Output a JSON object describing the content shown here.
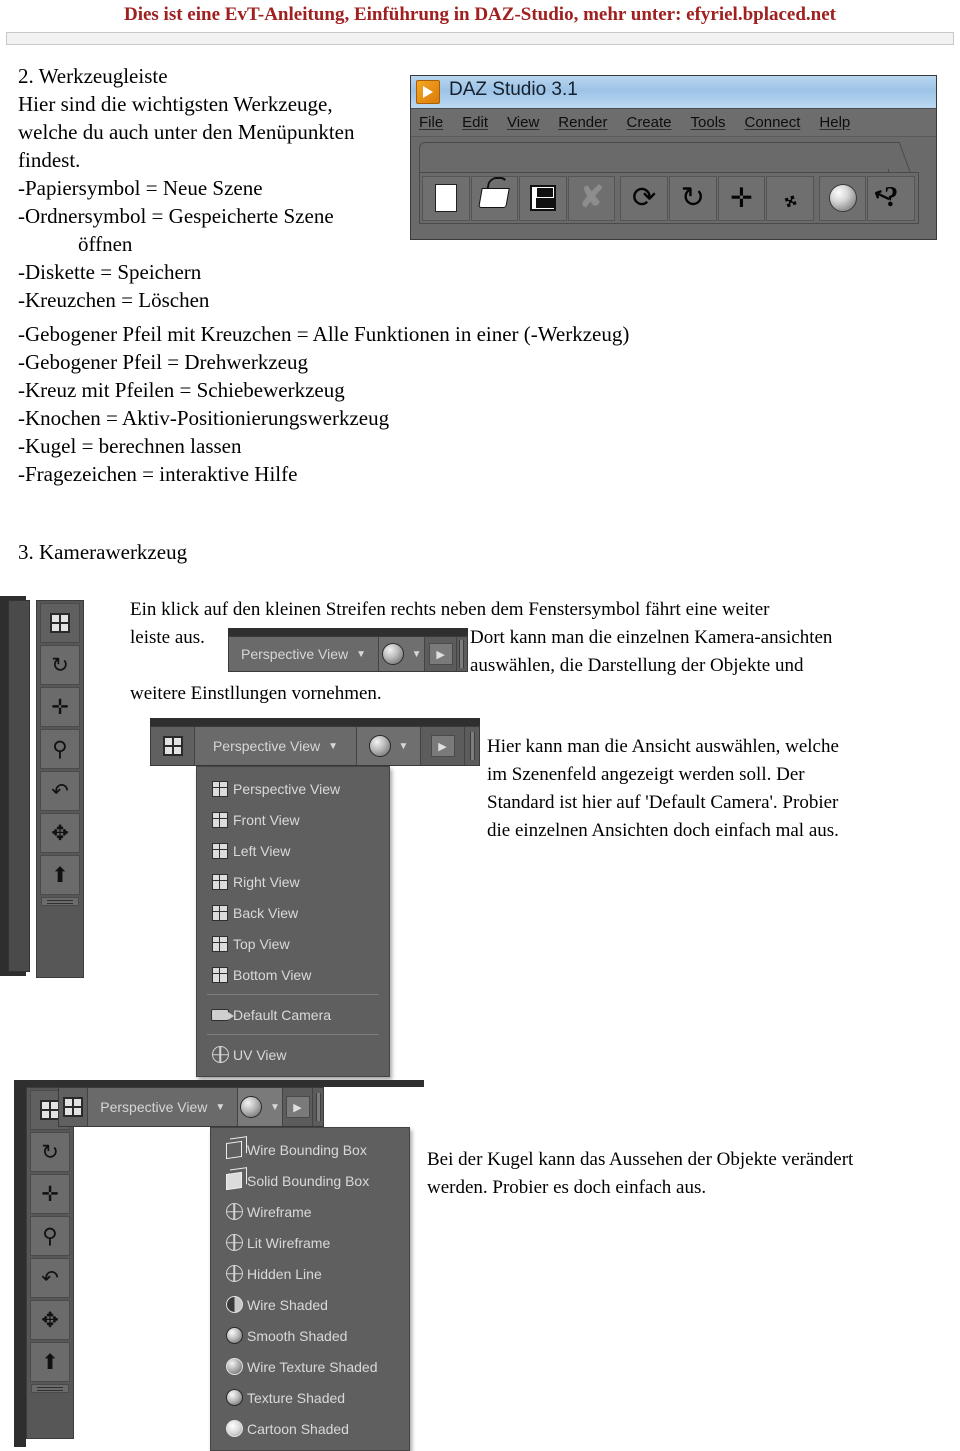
{
  "banner": {
    "text": "Dies ist eine EvT-Anleitung, Einführung in DAZ-Studio, mehr unter: efyriel.bplaced.net",
    "color": "#a02020"
  },
  "section2": {
    "heading": "2. Werkzeugleiste",
    "intro_lines": [
      "Hier sind die wichtigsten Werkzeuge,",
      "welche du auch unter den Menüpunkten",
      "findest."
    ],
    "bullets": [
      "-Papiersymbol = Neue Szene",
      "-Ordnersymbol = Gespeicherte Szene",
      "öffnen",
      "-Diskette = Speichern",
      "-Kreuzchen = Löschen"
    ],
    "wide_bullets": [
      "-Gebogener Pfeil mit Kreuzchen = Alle Funktionen in einer (-Werkzeug)",
      "-Gebogener Pfeil = Drehwerkzeug",
      "-Kreuz mit Pfeilen = Schiebewerkzeug",
      "-Knochen = Aktiv-Positionierungswerkzeug",
      "-Kugel = berechnen lassen",
      "-Fragezeichen = interaktive Hilfe"
    ]
  },
  "daz_window": {
    "title": "DAZ Studio 3.1",
    "menus": [
      "File",
      "Edit",
      "View",
      "Render",
      "Create",
      "Tools",
      "Connect",
      "Help"
    ],
    "toolbar_buttons": [
      {
        "name": "new-scene-button",
        "icon": "page-icon",
        "glyph": ""
      },
      {
        "name": "open-scene-button",
        "icon": "folder-icon",
        "glyph": ""
      },
      {
        "name": "save-scene-button",
        "icon": "floppy-disk-icon",
        "glyph": ""
      },
      {
        "name": "delete-button",
        "icon": "x-cross-icon",
        "glyph": "✘"
      },
      {
        "name": "universal-tool-button",
        "icon": "curved-arrow-cross-icon",
        "glyph": "↻"
      },
      {
        "name": "rotate-tool-button",
        "icon": "curved-arrow-icon",
        "glyph": "↻"
      },
      {
        "name": "translate-tool-button",
        "icon": "four-way-arrow-icon",
        "glyph": "✛"
      },
      {
        "name": "active-pose-tool-button",
        "icon": "bone-icon",
        "glyph": "🦴"
      },
      {
        "name": "render-button",
        "icon": "sphere-icon",
        "glyph": ""
      },
      {
        "name": "help-button",
        "icon": "question-mark-arrow-icon",
        "glyph": "?"
      }
    ]
  },
  "section3": {
    "heading": "3. Kamerawerkzeug",
    "para1_lines": [
      "Ein klick auf den kleinen Streifen rechts neben dem Fenstersymbol fährt eine weiter",
      "leiste aus.",
      "Dort kann man die einzelnen Kamera-ansichten",
      "auswählen, die Darstellung der Objekte und",
      "weitere Einstllungen vornehmen."
    ],
    "para2_lines": [
      "Hier kann man die Ansicht auswählen, welche",
      "im Szenenfeld angezeigt werden soll. Der",
      "Standard ist hier auf 'Default Camera'. Probier",
      "die einzelnen Ansichten doch einfach mal aus."
    ],
    "para3_lines": [
      "Bei der Kugel kann das Aussehen der Objekte verändert",
      "werden. Probier es doch einfach aus."
    ]
  },
  "viewport": {
    "current_view": "Perspective View",
    "tool_buttons": [
      {
        "name": "viewport-layout-button",
        "icon": "window-grid-icon",
        "glyph": ""
      },
      {
        "name": "orbit-tool-button",
        "icon": "orbit-arrow-icon",
        "glyph": "↻"
      },
      {
        "name": "pan-tool-button",
        "icon": "four-way-arrow-icon",
        "glyph": "✛"
      },
      {
        "name": "zoom-tool-button",
        "icon": "magnifier-icon",
        "glyph": "🔍"
      },
      {
        "name": "bank-rotate-tool-button",
        "icon": "arc-arrow-icon",
        "glyph": "↶"
      },
      {
        "name": "frame-tool-button",
        "icon": "converging-arrows-icon",
        "glyph": "✥"
      },
      {
        "name": "reset-camera-button",
        "icon": "up-arrow-circle-icon",
        "glyph": "⬆"
      }
    ]
  },
  "camera_menu": {
    "items": [
      {
        "label": "Perspective View",
        "icon": "grid-icon"
      },
      {
        "label": "Front View",
        "icon": "grid-icon"
      },
      {
        "label": "Left View",
        "icon": "grid-icon"
      },
      {
        "label": "Right View",
        "icon": "grid-icon"
      },
      {
        "label": "Back View",
        "icon": "grid-icon"
      },
      {
        "label": "Top View",
        "icon": "grid-icon"
      },
      {
        "label": "Bottom View",
        "icon": "grid-icon"
      },
      {
        "label": "Default Camera",
        "icon": "camera-icon"
      },
      {
        "label": "UV View",
        "icon": "globe-icon"
      }
    ]
  },
  "shading_menu": {
    "items": [
      {
        "label": "Wire Bounding Box",
        "icon": "wire-cube-icon"
      },
      {
        "label": "Solid Bounding Box",
        "icon": "solid-cube-icon"
      },
      {
        "label": "Wireframe",
        "icon": "wire-sphere-icon"
      },
      {
        "label": "Lit Wireframe",
        "icon": "lit-wire-sphere-icon"
      },
      {
        "label": "Hidden Line",
        "icon": "hidden-line-sphere-icon"
      },
      {
        "label": "Wire Shaded",
        "icon": "wire-shaded-sphere-icon"
      },
      {
        "label": "Smooth Shaded",
        "icon": "smooth-shaded-sphere-icon"
      },
      {
        "label": "Wire Texture Shaded",
        "icon": "wire-texture-sphere-icon"
      },
      {
        "label": "Texture Shaded",
        "icon": "texture-shaded-sphere-icon"
      },
      {
        "label": "Cartoon Shaded",
        "icon": "cartoon-shaded-sphere-icon"
      }
    ]
  }
}
